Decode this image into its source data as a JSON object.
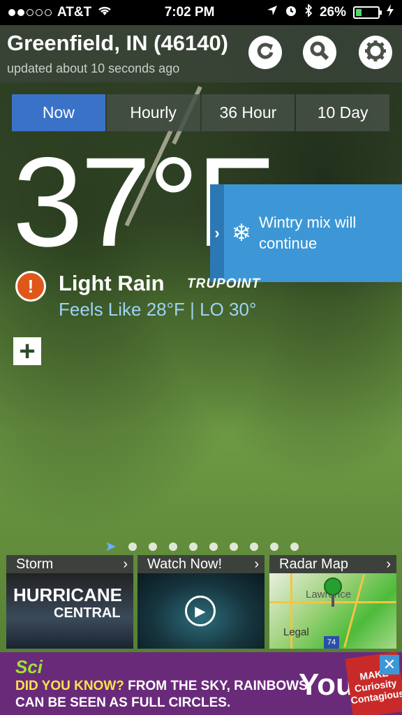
{
  "status_bar": {
    "carrier": "AT&T",
    "time": "7:02 PM",
    "battery": "26%",
    "battery_level": 0.26,
    "signal_bars": 2
  },
  "header": {
    "location": "Greenfield, IN (46140)",
    "updated": "updated about 10 seconds ago",
    "refresh_icon": "refresh-icon",
    "search_icon": "search-icon",
    "settings_icon": "gear-icon"
  },
  "tabs": [
    {
      "label": "Now",
      "active": true
    },
    {
      "label": "Hourly",
      "active": false
    },
    {
      "label": "36 Hour",
      "active": false
    },
    {
      "label": "10 Day",
      "active": false
    }
  ],
  "current": {
    "temperature": "37°F",
    "condition": "Light Rain",
    "feels_like": "Feels Like 28°F |  LO 30°",
    "brand": "TRUPOINT"
  },
  "alert_panel": {
    "message": "Wintry mix will continue",
    "icon": "snowflake-icon"
  },
  "pager": {
    "pages": 9,
    "active": 0
  },
  "cards": [
    {
      "title": "Storm",
      "image_text_1": "HURRICANE",
      "image_text_2": "CENTRAL"
    },
    {
      "title": "Watch Now!"
    },
    {
      "title": "Radar Map",
      "map_label": "Lawrence",
      "legal": "Legal",
      "road_shield": "74"
    }
  ],
  "ad": {
    "brand": "Sci",
    "line1_highlight": "DID YOU KNOW?",
    "line1_rest": " FROM THE SKY, RAINBOWS",
    "line2": "CAN BE SEEN AS FULL CIRCLES.",
    "right_text": "You",
    "badge": "MAKE Curiosity Contagious",
    "close": "✕"
  },
  "colors": {
    "active_tab": "#3a72c8",
    "alert_panel": "#3d97d6",
    "alert_icon": "#e0571a",
    "feels_like": "#9ed3f5"
  }
}
